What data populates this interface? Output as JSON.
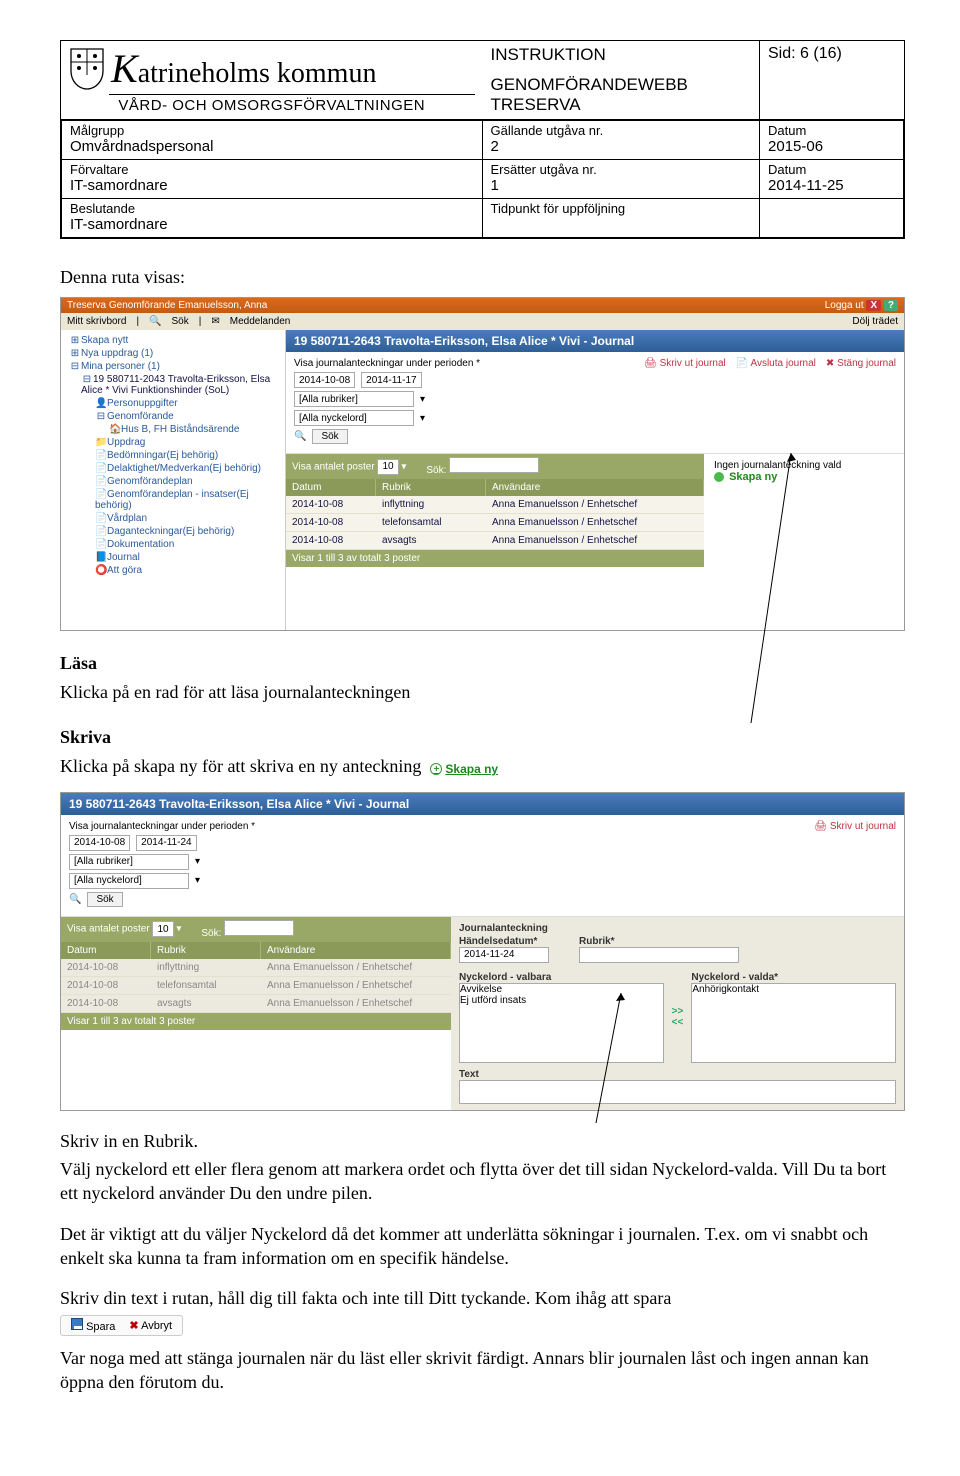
{
  "header": {
    "org_name_html": "atrineholms kommun",
    "sub_department": "VÅRD- OCH OMSORGSFÖRVALTNINGEN",
    "doc_type": "INSTRUKTION",
    "page_info": "Sid: 6 (16)",
    "doc_system1": "GENOMFÖRANDEWEBB",
    "doc_system2": "TRESERVA",
    "meta": {
      "malgrupp_label": "Målgrupp",
      "malgrupp": "Omvårdnadspersonal",
      "gallande_label": "Gällande utgåva nr.",
      "gallande": "2",
      "datum1_label": "Datum",
      "datum1": "2015-06",
      "forvaltare_label": "Förvaltare",
      "forvaltare": "IT-samordnare",
      "ersatter_label": "Ersätter utgåva nr.",
      "ersatter": "1",
      "datum2_label": "Datum",
      "datum2": "2014-11-25",
      "beslutande_label": "Beslutande",
      "beslutande": "IT-samordnare",
      "tidpunkt_label": "Tidpunkt för uppföljning",
      "tidpunkt": ""
    }
  },
  "body": {
    "intro": "Denna ruta visas:",
    "lasa_h": "Läsa",
    "lasa_p": "Klicka på en rad för att läsa journalanteckningen",
    "skriva_h": "Skriva",
    "skriva_p": "Klicka på skapa ny för att skriva en ny anteckning",
    "skapa_ny_label": "Skapa ny",
    "rubrik_p1": "Skriv in en Rubrik.",
    "rubrik_p2": "Välj nyckelord ett eller flera genom att markera ordet och flytta över det till sidan Nyckelord-valda. Vill Du ta bort ett nyckelord använder Du den undre pilen.",
    "viktigt_p": "Det är viktigt att du väljer Nyckelord då det kommer att underlätta sökningar i journalen. T.ex. om vi snabbt och enkelt ska kunna ta fram information om en specifik händelse.",
    "skrivtext_p": "Skriv din text i rutan, håll dig till fakta och inte till Ditt tyckande. Kom ihåg att spara",
    "spara_label": "Spara",
    "avbryt_label": "Avbryt",
    "noga_p": "Var noga med att stänga journalen när du läst eller skrivit färdigt. Annars blir journalen låst och ingen annan kan öppna den förutom du."
  },
  "app1": {
    "topbar_left": "Treserva Genomförande Emanuelsson, Anna",
    "topbar_logout": "Logga ut",
    "menubar_items": [
      "Mitt skrivbord",
      "Sök",
      "Meddelanden"
    ],
    "menubar_right": "Dölj trädet",
    "tree": [
      "Skapa nytt",
      "Nya uppdrag (1)",
      "Mina personer (1)",
      "19 580711-2043 Travolta-Eriksson, Elsa Alice * Vivi Funktionshinder (SoL)",
      "Personuppgifter",
      "Genomförande",
      "Hus B, FH Biståndsärende",
      "Uppdrag",
      "Bedömningar(Ej behörig)",
      "Delaktighet/Medverkan(Ej behörig)",
      "Genomförandeplan",
      "Genomförandeplan - insatser(Ej behörig)",
      "Vårdplan",
      "Daganteckningar(Ej behörig)",
      "Dokumentation",
      "Journal",
      "Att göra"
    ],
    "bluebar": "19 580711-2643 Travolta-Eriksson, Elsa Alice * Vivi - Journal",
    "filter_label": "Visa journalanteckningar under perioden *",
    "date_from": "2014-10-08",
    "date_to": "2014-11-17",
    "rubriker": "[Alla rubriker]",
    "nyckelord": "[Alla nyckelord]",
    "sok": "Sök",
    "tools": [
      "Skriv ut journal",
      "Avsluta journal",
      "Stäng journal"
    ],
    "greenbar_label": "Visa antalet poster",
    "greenbar_val": "10",
    "greenbar_sok": "Sök:",
    "thead": [
      "Datum",
      "Rubrik",
      "Användare"
    ],
    "rows": [
      {
        "d": "2014-10-08",
        "r": "inflyttning",
        "u": "Anna Emanuelsson / Enhetschef"
      },
      {
        "d": "2014-10-08",
        "r": "telefonsamtal",
        "u": "Anna Emanuelsson / Enhetschef"
      },
      {
        "d": "2014-10-08",
        "r": "avsagts",
        "u": "Anna Emanuelsson / Enhetschef"
      }
    ],
    "foot": "Visar 1 till 3 av totalt 3 poster",
    "right_none": "Ingen journalanteckning vald",
    "right_skapa": "Skapa ny"
  },
  "app2": {
    "bluebar": "19 580711-2643 Travolta-Eriksson, Elsa Alice * Vivi - Journal",
    "filter_label": "Visa journalanteckningar under perioden *",
    "date_from": "2014-10-08",
    "date_to": "2014-11-24",
    "rubriker": "[Alla rubriker]",
    "nyckelord": "[Alla nyckelord]",
    "sok": "Sök",
    "tool": "Skriv ut journal",
    "greenbar_label": "Visa antalet poster",
    "greenbar_val": "10",
    "greenbar_sok": "Sök:",
    "thead": [
      "Datum",
      "Rubrik",
      "Användare"
    ],
    "rows": [
      {
        "d": "2014-10-08",
        "r": "inflyttning",
        "u": "Anna Emanuelsson / Enhetschef"
      },
      {
        "d": "2014-10-08",
        "r": "telefonsamtal",
        "u": "Anna Emanuelsson / Enhetschef"
      },
      {
        "d": "2014-10-08",
        "r": "avsagts",
        "u": "Anna Emanuelsson / Enhetschef"
      }
    ],
    "foot": "Visar 1 till 3 av totalt 3 poster",
    "ja_label": "Journalanteckning",
    "hdatum_label": "Händelsedatum*",
    "hdatum": "2014-11-24",
    "rubrik_label": "Rubrik*",
    "nyck_valbara_label": "Nyckelord - valbara",
    "nyck_valbara": [
      "Avvikelse",
      "Ej utförd insats"
    ],
    "nyck_valda_label": "Nyckelord - valda*",
    "nyck_valda": [
      "Anhörigkontakt"
    ],
    "arrow_r": ">>",
    "arrow_l": "<<",
    "text_label": "Text"
  }
}
